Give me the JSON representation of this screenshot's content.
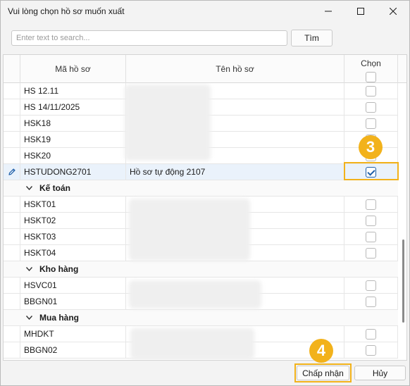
{
  "window": {
    "title": "Vui lòng chọn hồ sơ muốn xuất"
  },
  "search": {
    "placeholder": "Enter text to search...",
    "value": "",
    "button_label": "Tìm"
  },
  "columns": {
    "code": "Mã hồ sơ",
    "name": "Tên hồ sơ",
    "chosen": "Chọn"
  },
  "rows": [
    {
      "type": "data",
      "code": "HS 12.11",
      "name": "",
      "checked": false
    },
    {
      "type": "data",
      "code": "HS 14/11/2025",
      "name": "",
      "checked": false
    },
    {
      "type": "data",
      "code": "HSK18",
      "name": "",
      "checked": false
    },
    {
      "type": "data",
      "code": "HSK19",
      "name": "",
      "checked": false
    },
    {
      "type": "data",
      "code": "HSK20",
      "name": "",
      "checked": false
    },
    {
      "type": "data",
      "code": "HSTUDONG2701",
      "name": "Hồ sơ tự động 2107",
      "checked": true,
      "selected": true
    },
    {
      "type": "group",
      "label": "Kế toán"
    },
    {
      "type": "data",
      "code": "HSKT01",
      "name": "",
      "checked": false
    },
    {
      "type": "data",
      "code": "HSKT02",
      "name": "",
      "checked": false
    },
    {
      "type": "data",
      "code": "HSKT03",
      "name": "",
      "checked": false
    },
    {
      "type": "data",
      "code": "HSKT04",
      "name": "",
      "checked": false
    },
    {
      "type": "group",
      "label": "Kho hàng"
    },
    {
      "type": "data",
      "code": "HSVC01",
      "name": "",
      "checked": false
    },
    {
      "type": "data",
      "code": "BBGN01",
      "name": "",
      "checked": false
    },
    {
      "type": "group",
      "label": "Mua hàng"
    },
    {
      "type": "data",
      "code": "MHDKT",
      "name": "",
      "checked": false
    },
    {
      "type": "data",
      "code": "BBGN02",
      "name": "",
      "checked": false
    }
  ],
  "annotations": [
    {
      "number": "3"
    },
    {
      "number": "4"
    }
  ],
  "footer": {
    "accept_label": "Chấp nhận",
    "cancel_label": "Hủy"
  },
  "colors": {
    "highlight": "#f2b21b",
    "selected_row": "#eaf2fb",
    "checkbox_checked": "#1f5fa8"
  },
  "icons": {
    "edit": "pencil-icon",
    "group_toggle": "chevron-down-icon",
    "minimize": "minimize-icon",
    "maximize": "maximize-icon",
    "close": "close-icon"
  }
}
